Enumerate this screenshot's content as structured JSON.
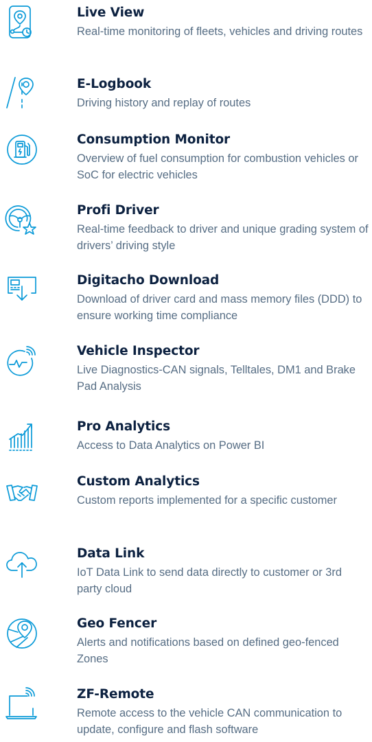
{
  "accent_color": "#0a9ad8",
  "title_color": "#0c2140",
  "text_color": "#566d84",
  "features": [
    {
      "icon": "route-map-pin-icon",
      "title": "Live View",
      "description": "Real-time monitoring of fleets, vehicles and driving routes"
    },
    {
      "icon": "road-location-pin-icon",
      "title": "E-Logbook",
      "description": "Driving history and replay of routes"
    },
    {
      "icon": "fuel-pump-icon",
      "title": "Consumption Monitor",
      "description": "Overview of fuel consumption for combustion vehicles or SoC for electric vehicles"
    },
    {
      "icon": "steering-wheel-star-icon",
      "title": "Profi Driver",
      "description": "Real-time feedback to driver and unique grading system of drivers’ driving style"
    },
    {
      "icon": "card-download-icon",
      "title": "Digitacho Download",
      "description": "Download of driver card and mass memory files (DDD) to ensure working time compliance"
    },
    {
      "icon": "diagnostics-signal-icon",
      "title": "Vehicle Inspector",
      "description": "Live Diagnostics-CAN signals, Telltales, DM1 and Brake Pad Analysis"
    },
    {
      "icon": "bar-chart-growth-icon",
      "title": "Pro Analytics",
      "description": "Access to Data Analytics on Power BI"
    },
    {
      "icon": "handshake-icon",
      "title": "Custom Analytics",
      "description": "Custom reports implemented for a specific customer"
    },
    {
      "icon": "cloud-upload-icon",
      "title": "Data Link",
      "description": "IoT Data Link to send data directly to customer or 3rd party cloud"
    },
    {
      "icon": "geofence-pin-icon",
      "title": "Geo Fencer",
      "description": "Alerts and notifications based on defined geo-fenced Zones"
    },
    {
      "icon": "laptop-remote-signal-icon",
      "title": "ZF-Remote",
      "description": "Remote access to the vehicle CAN communicati­on to update, configure and flash software"
    }
  ]
}
